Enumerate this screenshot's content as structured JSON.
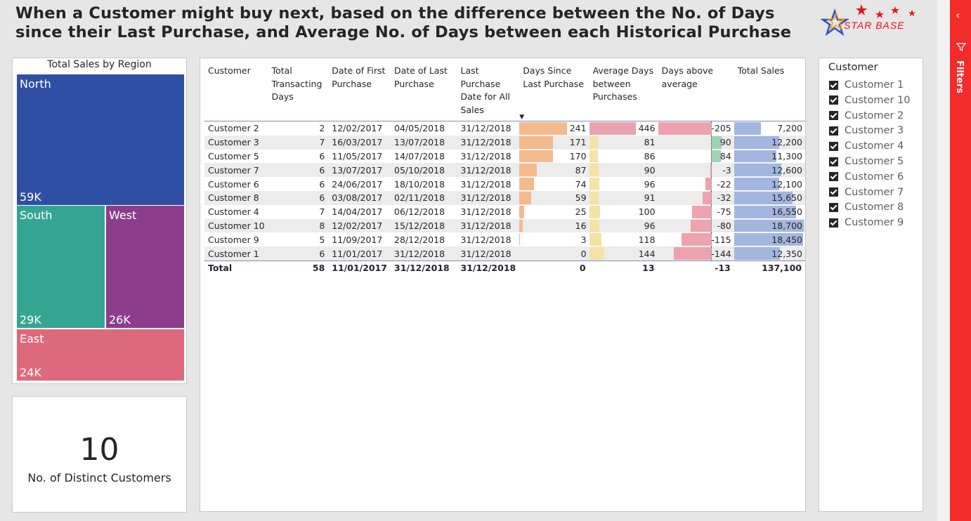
{
  "title": "When a Customer might buy next, based on the difference between the No. of Days since their Last Purchase, and Average No. of Days between each Historical Purchase",
  "logo": {
    "text": "STAR BASE",
    "icon": "star-logo-icon",
    "colors": [
      "#e8141b",
      "#2b4fd6",
      "#f7a100",
      "#1ba34a"
    ]
  },
  "treemap": {
    "title": "Total Sales by Region",
    "tiles": [
      {
        "name": "North",
        "value": "59K",
        "color": "#2e4fa4"
      },
      {
        "name": "South",
        "value": "29K",
        "color": "#35a593"
      },
      {
        "name": "West",
        "value": "26K",
        "color": "#8b3d8b"
      },
      {
        "name": "East",
        "value": "24K",
        "color": "#dc6a7c"
      }
    ]
  },
  "kpi": {
    "value": "10",
    "label": "No. of Distinct Customers"
  },
  "table": {
    "headers": [
      "Customer",
      "Total Transacting Days",
      "Date of First Purchase",
      "Date of Last Purchase",
      "Last Purchase Date for All Sales",
      "Days Since Last Purchase",
      "Average Days between Purchases",
      "Days above average",
      "Total Sales"
    ],
    "sort_icon": "sort-descending-icon",
    "rows": [
      {
        "customer": "Customer 2",
        "days": "2",
        "first": "12/02/2017",
        "last": "04/05/2018",
        "all_last": "31/12/2018",
        "since": 241,
        "avg": 446,
        "above": -205,
        "sales": 7200,
        "sales_text": "7,200"
      },
      {
        "customer": "Customer 3",
        "days": "7",
        "first": "16/03/2017",
        "last": "13/07/2018",
        "all_last": "31/12/2018",
        "since": 171,
        "avg": 81,
        "above": 90,
        "sales": 12200,
        "sales_text": "12,200"
      },
      {
        "customer": "Customer 5",
        "days": "6",
        "first": "11/05/2017",
        "last": "14/07/2018",
        "all_last": "31/12/2018",
        "since": 170,
        "avg": 86,
        "above": 84,
        "sales": 11300,
        "sales_text": "11,300"
      },
      {
        "customer": "Customer 7",
        "days": "6",
        "first": "13/07/2017",
        "last": "05/10/2018",
        "all_last": "31/12/2018",
        "since": 87,
        "avg": 90,
        "above": -3,
        "sales": 12600,
        "sales_text": "12,600"
      },
      {
        "customer": "Customer 6",
        "days": "6",
        "first": "24/06/2017",
        "last": "18/10/2018",
        "all_last": "31/12/2018",
        "since": 74,
        "avg": 96,
        "above": -22,
        "sales": 12100,
        "sales_text": "12,100"
      },
      {
        "customer": "Customer 8",
        "days": "6",
        "first": "03/08/2017",
        "last": "02/11/2018",
        "all_last": "31/12/2018",
        "since": 59,
        "avg": 91,
        "above": -32,
        "sales": 15650,
        "sales_text": "15,650"
      },
      {
        "customer": "Customer 4",
        "days": "7",
        "first": "14/04/2017",
        "last": "06/12/2018",
        "all_last": "31/12/2018",
        "since": 25,
        "avg": 100,
        "above": -75,
        "sales": 16550,
        "sales_text": "16,550"
      },
      {
        "customer": "Customer 10",
        "days": "8",
        "first": "12/02/2017",
        "last": "15/12/2018",
        "all_last": "31/12/2018",
        "since": 16,
        "avg": 96,
        "above": -80,
        "sales": 18700,
        "sales_text": "18,700"
      },
      {
        "customer": "Customer 9",
        "days": "5",
        "first": "11/09/2017",
        "last": "28/12/2018",
        "all_last": "31/12/2018",
        "since": 3,
        "avg": 118,
        "above": -115,
        "sales": 18450,
        "sales_text": "18,450"
      },
      {
        "customer": "Customer 1",
        "days": "6",
        "first": "11/01/2017",
        "last": "31/12/2018",
        "all_last": "31/12/2018",
        "since": 0,
        "avg": 144,
        "above": -144,
        "sales": 12350,
        "sales_text": "12,350"
      }
    ],
    "total": {
      "label": "Total",
      "days": "58",
      "first": "11/01/2017",
      "last": "31/12/2018",
      "all_last": "31/12/2018",
      "since": "0",
      "avg": "13",
      "above": "-13",
      "sales": "137,100"
    },
    "colors": {
      "since_bar": "#f5b98e",
      "avg_bar_high": "#e8a3ae",
      "avg_bar": "#f5e2a6",
      "above_pos": "#9fd3b5",
      "above_neg": "#eda2ae",
      "sales_bar": "#a3b6e0"
    }
  },
  "slicer": {
    "title": "Customer",
    "items": [
      "Customer 1",
      "Customer 10",
      "Customer 2",
      "Customer 3",
      "Customer 4",
      "Customer 5",
      "Customer 6",
      "Customer 7",
      "Customer 8",
      "Customer 9"
    ],
    "checked": true
  },
  "filters_pane": {
    "label": "Filters",
    "icons": [
      "chevron-left-icon",
      "funnel-icon"
    ]
  }
}
